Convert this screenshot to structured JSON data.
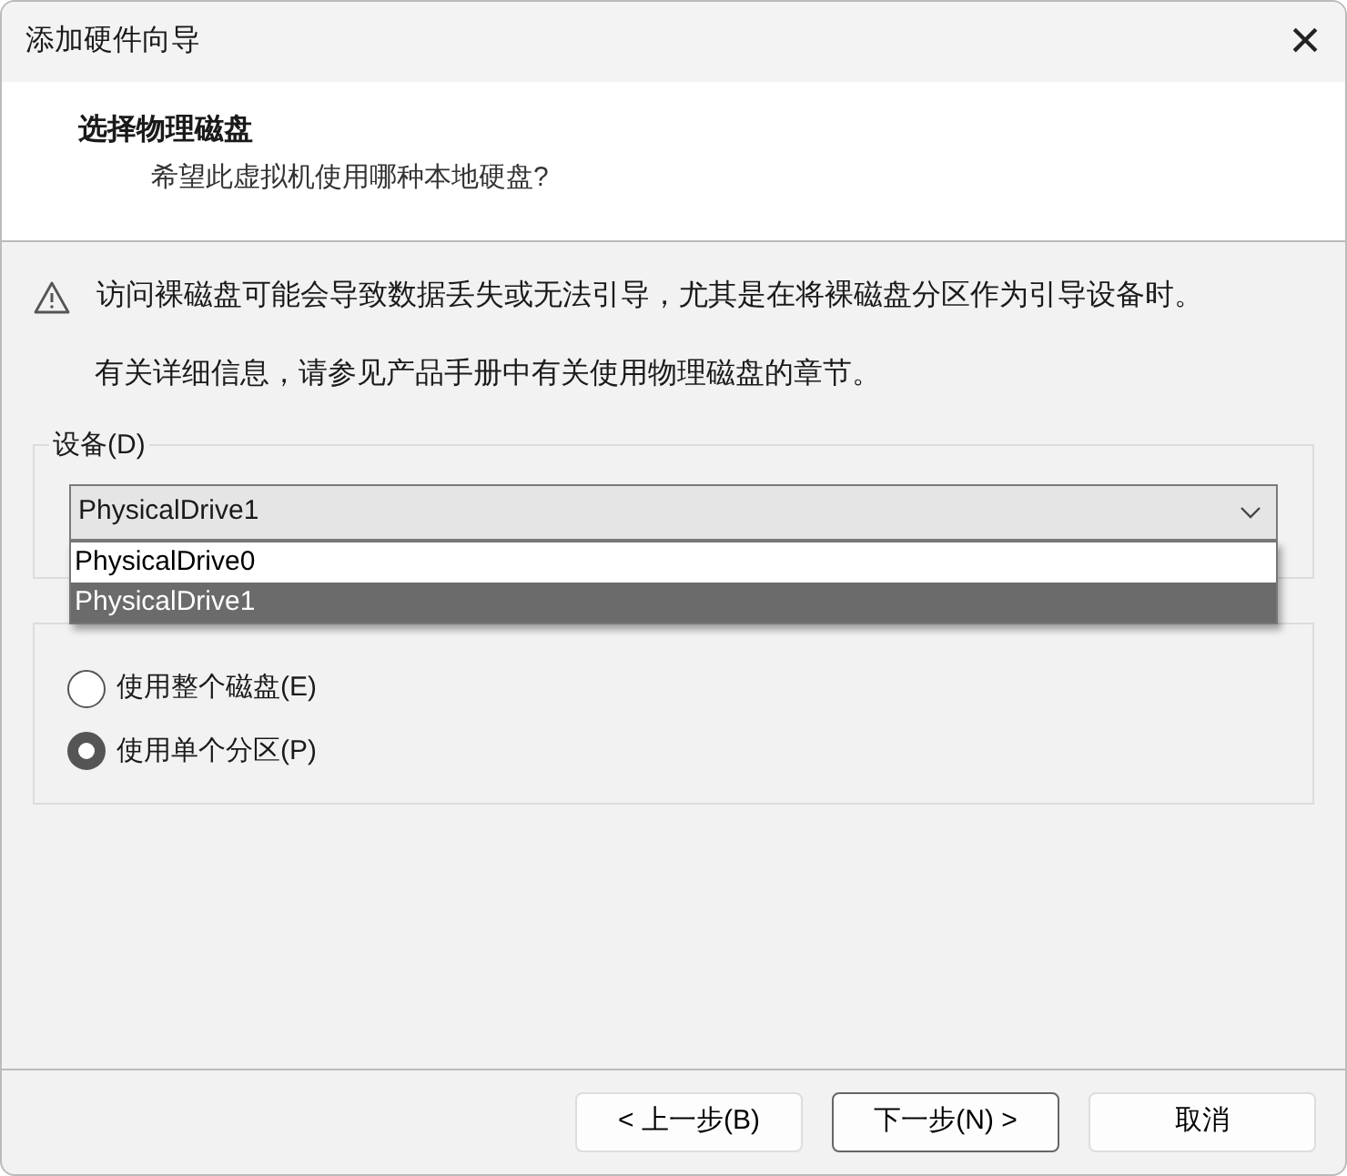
{
  "window": {
    "title": "添加硬件向导",
    "close": "×"
  },
  "header": {
    "title": "选择物理磁盘",
    "subtitle": "希望此虚拟机使用哪种本地硬盘?"
  },
  "warning": "访问裸磁盘可能会导致数据丢失或无法引导，尤其是在将裸磁盘分区作为引导设备时。",
  "info": "有关详细信息，请参见产品手册中有关使用物理磁盘的章节。",
  "device": {
    "label": "设备(D)",
    "value": "PhysicalDrive1",
    "expanded": true,
    "options": [
      {
        "label": "PhysicalDrive0",
        "selected": false
      },
      {
        "label": "PhysicalDrive1",
        "selected": true
      }
    ]
  },
  "usage": {
    "options": [
      {
        "label": "使用整个磁盘(E)",
        "selected": false
      },
      {
        "label": "使用单个分区(P)",
        "selected": true
      }
    ]
  },
  "buttons": [
    {
      "label": "< 上一步(B)",
      "default": false
    },
    {
      "label": "下一步(N) >",
      "default": true
    },
    {
      "label": "取消",
      "default": false
    }
  ]
}
